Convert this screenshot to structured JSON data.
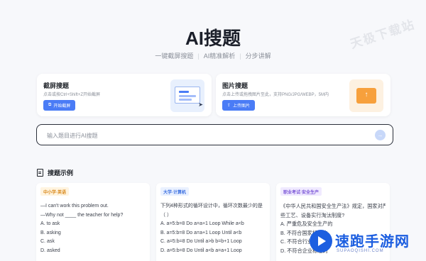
{
  "watermark_top": "天极下载站",
  "title": "AI搜题",
  "subtitle": [
    "一键截屏搜题",
    "AI精准解析",
    "分步讲解"
  ],
  "cards": {
    "screenshot": {
      "title": "截屏搜题",
      "desc": "点击或按Ctrl+Shift+Z开始截屏",
      "button": "开始截屏",
      "icon": "screenshot-window-icon"
    },
    "image": {
      "title": "图片搜题",
      "desc": "点击上传或拖拽图片至此，支持PNG/JPG/WEBP，5M内",
      "button": "上传图片",
      "icon": "upload-folder-icon"
    }
  },
  "search": {
    "placeholder": "输入题目进行AI搜题",
    "value": ""
  },
  "examples": {
    "heading": "搜题示例",
    "items": [
      {
        "tag": "中小学·英语",
        "lines": [
          "—I can't work this problem out.",
          "—Why not ____ the teacher for help?",
          "A. to ask",
          "B. asking",
          "C. ask",
          "D. asked"
        ]
      },
      {
        "tag": "大学·计算机",
        "lines": [
          "下列4种形式的循环设计中，循环次数最少的是",
          "（ ）",
          "A. a=5:b=8 Do a=a+1 Loop While a<b",
          "B. a=5:b=8 Do a=a+1 Loop Until a<b",
          "C. a=5:b=8 Do Until a>b b=b+1 Loop",
          "D. a=5:b=8 Do Until a<b a=a+1 Loop"
        ]
      },
      {
        "tag": "职业考试·安全生产",
        "lines": [
          "《中华人民共和国安全生产法》规定，国家对严",
          "些工艺、设备实行淘汰制度?",
          "A. 严重危及安全生产的",
          "B. 不符合国家标准的",
          "C. 不符合行业标准的",
          "D. 不符合企业标准的"
        ]
      }
    ]
  },
  "watermark_bottom": {
    "name": "速跑手游网",
    "sub": "SUPAOQISHI.COM"
  },
  "colors": {
    "accent": "#4a7cf6",
    "brand_watermark": "#1c5ee0"
  }
}
